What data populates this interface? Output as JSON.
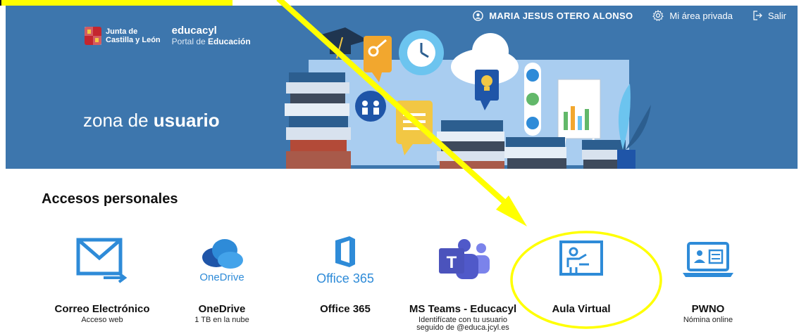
{
  "header": {
    "user_name": "MARIA JESUS OTERO ALONSO",
    "private_area": "Mi área privada",
    "logout": "Salir"
  },
  "brand": {
    "junta_line1": "Junta de",
    "junta_line2": "Castilla y León",
    "portal_title": "educacyl",
    "portal_sub_prefix": "Portal de ",
    "portal_sub_bold": "Educación"
  },
  "hero": {
    "zona_prefix": "zona de ",
    "zona_bold": "usuario"
  },
  "section": {
    "title": "Accesos personales"
  },
  "cards": [
    {
      "name": "Correo Electrónico",
      "desc": "Acceso web",
      "icon": "mail-icon"
    },
    {
      "name": "OneDrive",
      "desc": "1 TB en la nube",
      "icon": "onedrive-icon",
      "icon_text": "OneDrive"
    },
    {
      "name": "Office 365",
      "desc": "",
      "icon": "office365-icon",
      "icon_text": "Office 365"
    },
    {
      "name": "MS Teams - Educacyl",
      "desc_line1": "Identifícate con tu usuario",
      "desc_line2": "seguido de @educa.jcyl.es",
      "icon": "teams-icon"
    },
    {
      "name": "Aula Virtual",
      "desc": "",
      "icon": "classroom-icon"
    },
    {
      "name": "PWNO",
      "desc": "Nómina online",
      "icon": "payroll-icon"
    }
  ],
  "colors": {
    "hero_bg": "#3d76ad",
    "icon_blue": "#2e8bd8",
    "highlight": "#ffff00"
  }
}
